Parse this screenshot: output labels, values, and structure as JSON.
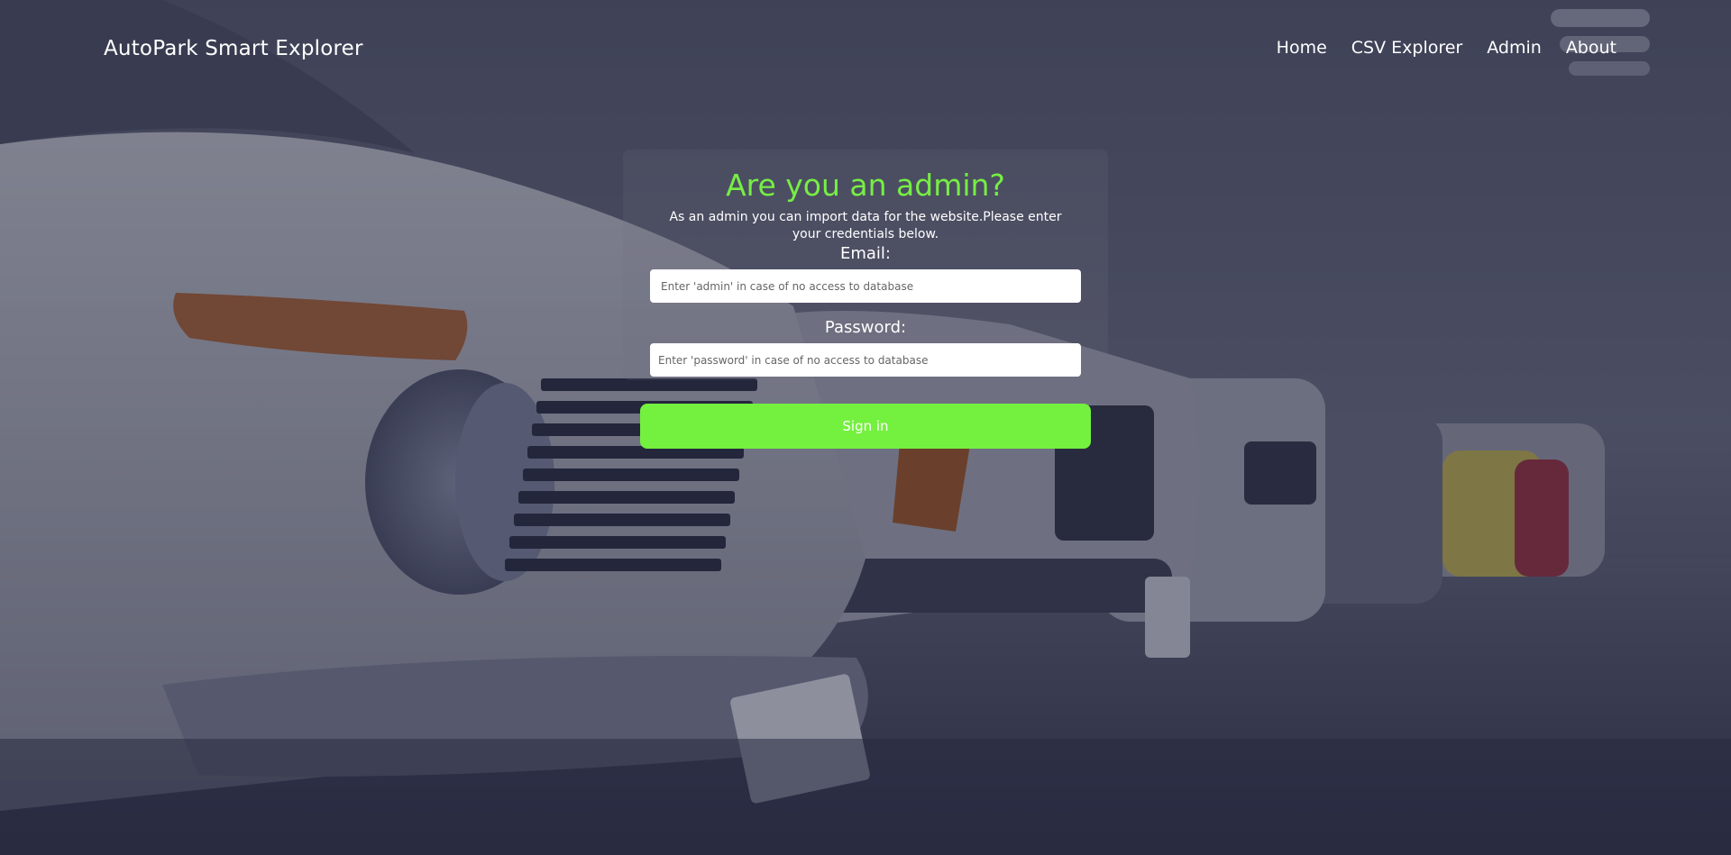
{
  "header": {
    "brand": "AutoPark Smart Explorer",
    "nav": [
      {
        "label": "Home"
      },
      {
        "label": "CSV Explorer"
      },
      {
        "label": "Admin"
      },
      {
        "label": "About"
      }
    ]
  },
  "login": {
    "title": "Are you an admin?",
    "subtitle": "As an admin you can import data for the website.Please enter your credentials below.",
    "email_label": "Email:",
    "email_placeholder": "Enter 'admin' in case of no access to database",
    "password_label": "Password:",
    "password_placeholder": "Enter 'password' in case of no access to database",
    "submit_label": "Sign in"
  },
  "colors": {
    "accent": "#74f03f",
    "title": "#77ee44",
    "overlay": "#262840"
  },
  "background": {
    "icon": "parked-cars-photo"
  }
}
